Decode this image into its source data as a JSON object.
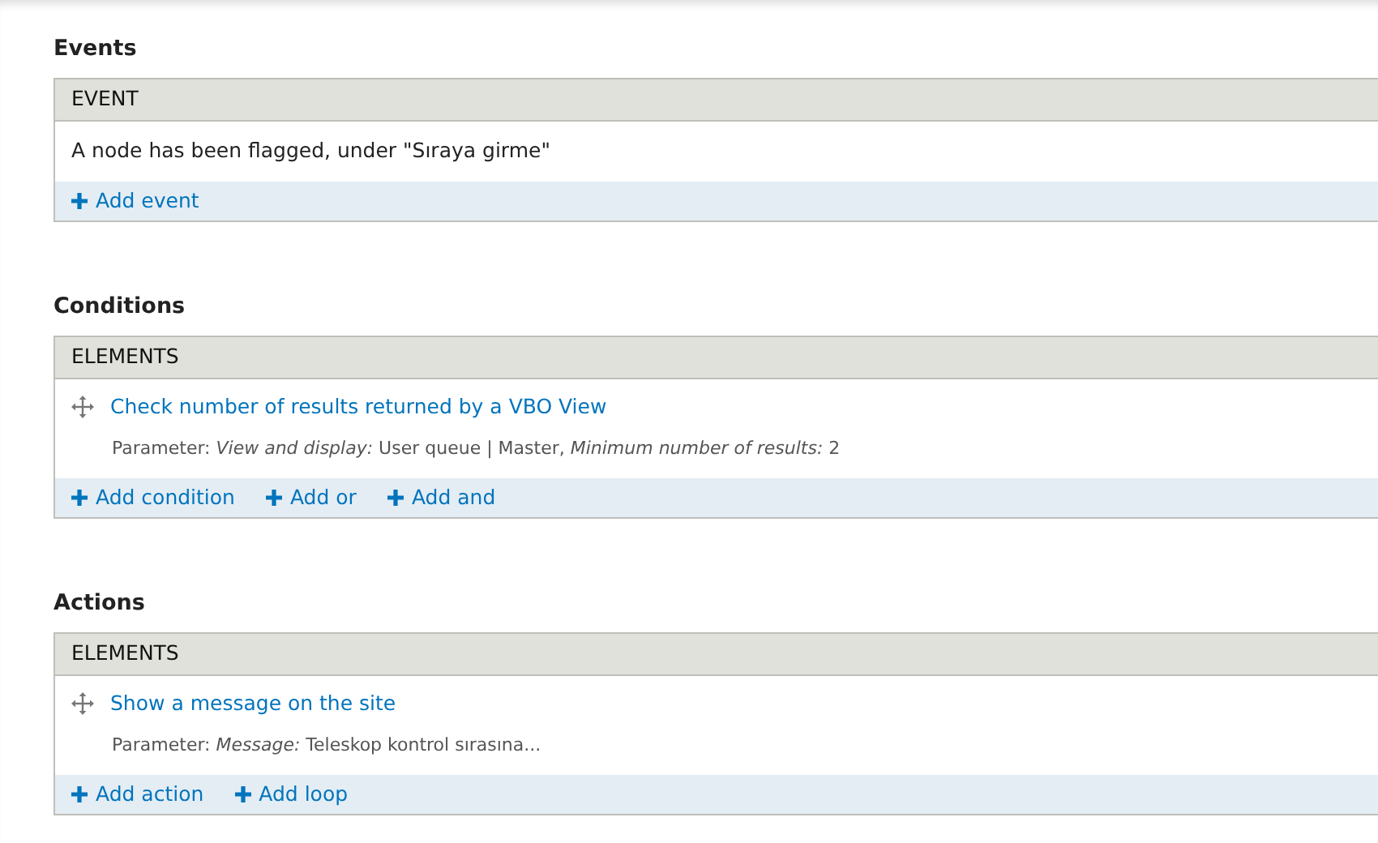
{
  "sections": [
    {
      "title": "Events",
      "column": "EVENT",
      "rows": [
        {
          "kind": "text",
          "label": "A node has been flagged, under \"Sıraya girme\""
        }
      ],
      "links": [
        "Add event"
      ]
    },
    {
      "title": "Conditions",
      "column": "ELEMENTS",
      "rows": [
        {
          "kind": "element",
          "label": "Check number of results returned by a VBO View",
          "parameter": "Parameter: *View and display:* User queue | Master, *Minimum number of results:* 2"
        }
      ],
      "links": [
        "Add condition",
        "Add or",
        "Add and"
      ]
    },
    {
      "title": "Actions",
      "column": "ELEMENTS",
      "rows": [
        {
          "kind": "element",
          "label": "Show a message on the site",
          "parameter": "Parameter: *Message:* Teleskop kontrol sırasına..."
        }
      ],
      "links": [
        "Add action",
        "Add loop"
      ]
    }
  ]
}
